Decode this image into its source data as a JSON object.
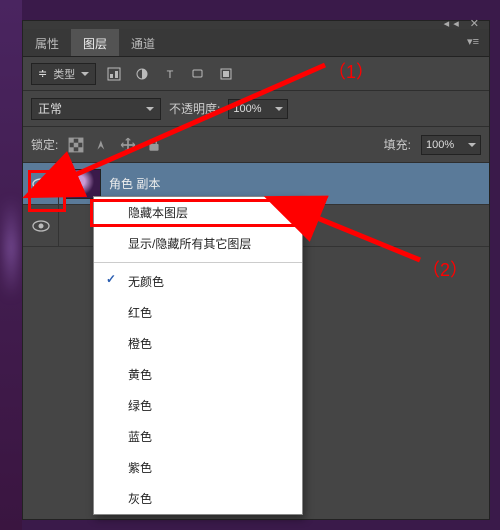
{
  "tabs": {
    "props": "属性",
    "layers": "图层",
    "channels": "通道"
  },
  "toolbar": {
    "kind_label": "类型",
    "kind_caret": "≑"
  },
  "blend": {
    "mode": "正常",
    "opacity_label": "不透明度:",
    "opacity_value": "100%"
  },
  "lock": {
    "label": "锁定:",
    "fill_label": "填充:",
    "fill_value": "100%"
  },
  "layers": {
    "item0_name": "角色 副本"
  },
  "menu": {
    "hide_this": "隐藏本图层",
    "toggle_others": "显示/隐藏所有其它图层",
    "no_color": "无颜色",
    "red": "红色",
    "orange": "橙色",
    "yellow": "黄色",
    "green": "绿色",
    "blue": "蓝色",
    "purple": "紫色",
    "gray": "灰色"
  },
  "markers": {
    "one": "（1）",
    "two": "（2）"
  }
}
